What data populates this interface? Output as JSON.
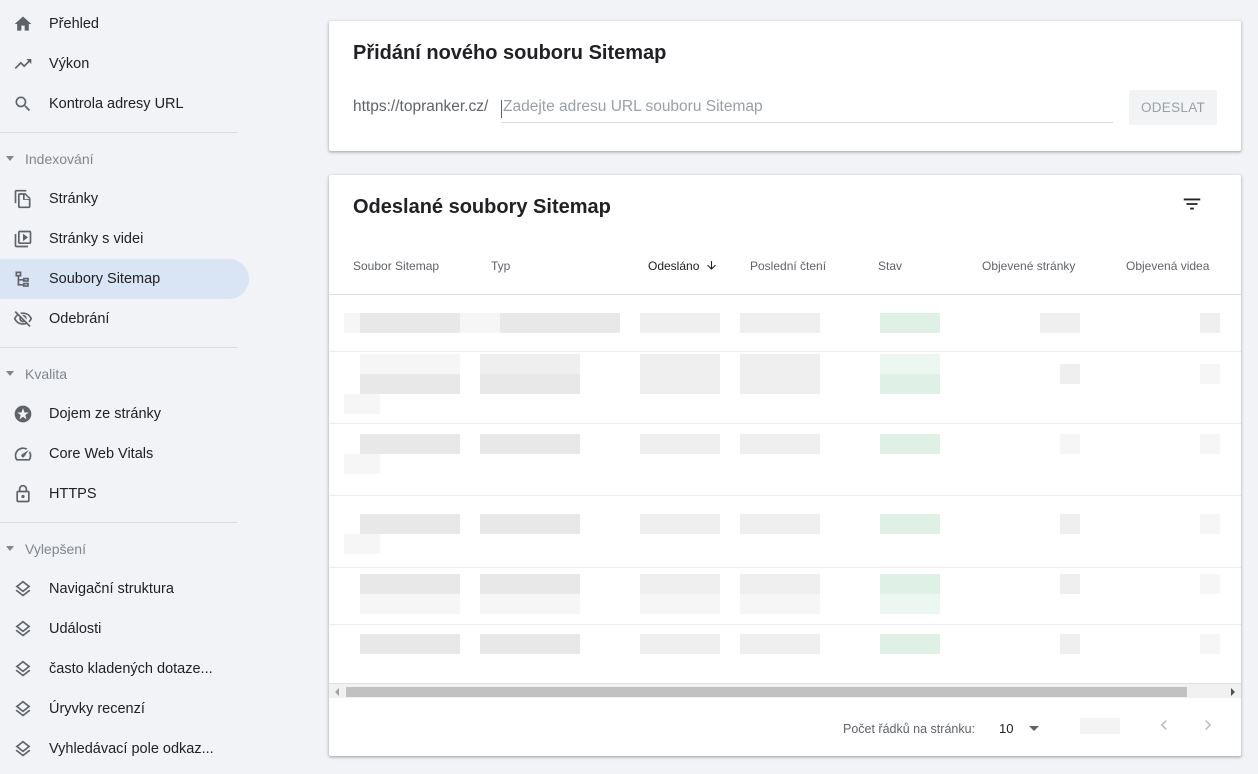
{
  "sidebar": {
    "top_items": [
      {
        "label": "Přehled",
        "icon": "home-icon"
      },
      {
        "label": "Výkon",
        "icon": "trending-up-icon"
      },
      {
        "label": "Kontrola adresy URL",
        "icon": "search-icon"
      }
    ],
    "sections": [
      {
        "title": "Indexování",
        "items": [
          {
            "label": "Stránky",
            "icon": "pages-icon"
          },
          {
            "label": "Stránky s videi",
            "icon": "video-pages-icon"
          },
          {
            "label": "Soubory Sitemap",
            "icon": "sitemap-icon",
            "active": true
          },
          {
            "label": "Odebrání",
            "icon": "eye-off-icon"
          }
        ]
      },
      {
        "title": "Kvalita",
        "items": [
          {
            "label": "Dojem ze stránky",
            "icon": "page-experience-icon"
          },
          {
            "label": "Core Web Vitals",
            "icon": "gauge-icon"
          },
          {
            "label": "HTTPS",
            "icon": "lock-icon"
          }
        ]
      },
      {
        "title": "Vylepšení",
        "items": [
          {
            "label": "Navigační struktura",
            "icon": "layers-icon"
          },
          {
            "label": "Události",
            "icon": "layers-icon"
          },
          {
            "label": "často kladených dotaze...",
            "icon": "layers-icon"
          },
          {
            "label": "Úryvky recenzí",
            "icon": "layers-icon"
          },
          {
            "label": "Vyhledávací pole odkaz...",
            "icon": "layers-icon"
          }
        ]
      }
    ]
  },
  "add_sitemap": {
    "title": "Přidání nového souboru Sitemap",
    "url_prefix": "https://topranker.cz/",
    "input_placeholder": "Zadejte adresu URL souboru Sitemap",
    "input_value": "",
    "submit_label": "ODESLAT"
  },
  "submitted": {
    "title": "Odeslané soubory Sitemap",
    "filter_icon": "filter-icon",
    "columns": [
      "Soubor Sitemap",
      "Typ",
      "Odesláno",
      "Poslední čtení",
      "Stav",
      "Objevené stránky",
      "Objevená videa"
    ],
    "sorted_column": "Odesláno",
    "sort_direction": "descending"
  },
  "pagination": {
    "rows_per_page_label": "Počet řádků na stránku:",
    "rows_per_page_value": "10"
  },
  "colors": {
    "active_nav_bg": "#d9e4f5",
    "status_green": "#dff1e7"
  }
}
